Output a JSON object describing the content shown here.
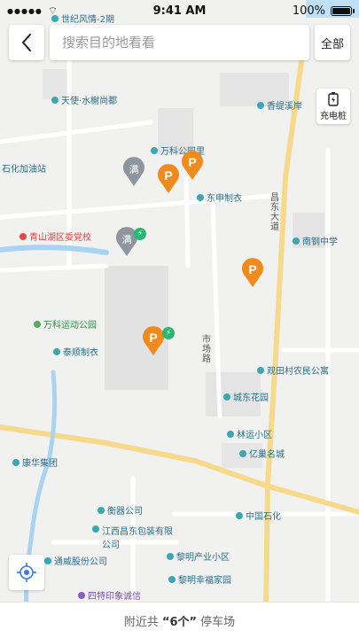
{
  "status_bar": {
    "time": "9:41 AM",
    "battery": "100%"
  },
  "search": {
    "placeholder": "搜索目的地看看"
  },
  "buttons": {
    "all": "全部",
    "charging": "充电桩"
  },
  "bottom_bar": {
    "prefix": "附近共",
    "count": "“6个”",
    "suffix": "停车场"
  },
  "road_labels": {
    "changdong": "昌东大道",
    "shichang": "市场路"
  },
  "markers": {
    "parking": "P",
    "full": "满"
  },
  "pois": [
    {
      "name": "世纪风情-2期"
    },
    {
      "name": "天使·水榭尚都"
    },
    {
      "name": "香缇溪岸"
    },
    {
      "name": "万科公园里"
    },
    {
      "name": "东申制衣"
    },
    {
      "name": "石化加油站"
    },
    {
      "name": "青山湖区委党校"
    },
    {
      "name": "南钢中学"
    },
    {
      "name": "万科运动公园"
    },
    {
      "name": "泰顺制衣"
    },
    {
      "name": "观田村农民公寓"
    },
    {
      "name": "城东花园"
    },
    {
      "name": "林运小区"
    },
    {
      "name": "亿巢名城"
    },
    {
      "name": "康华集团"
    },
    {
      "name": "衡器公司"
    },
    {
      "name": "中国石化"
    },
    {
      "name": "江西昌东包装有限公司"
    },
    {
      "name": "黎明产业小区"
    },
    {
      "name": "通威股份公司"
    },
    {
      "name": "黎明幸福家园"
    },
    {
      "name": "四特印象诚信"
    }
  ],
  "colors": {
    "road_main": "#f6d98a",
    "water": "#a9d3f2",
    "parking_pin": "#f08a1c",
    "full_pin": "#8e959e",
    "poi_teal": "#3aa8b4",
    "poi_red": "#e04848"
  }
}
